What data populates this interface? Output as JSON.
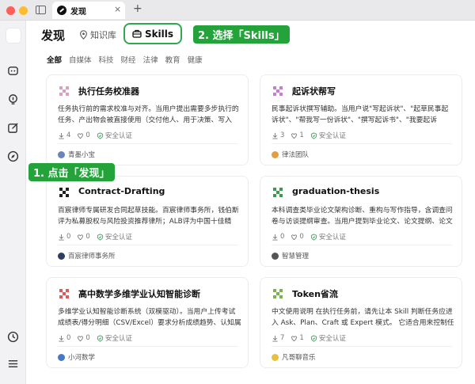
{
  "window": {
    "tab_title": "发现",
    "tab_close": "×",
    "tab_add": "+"
  },
  "header": {
    "title": "发现",
    "knowledge_tab": "知识库",
    "skills_tab": "Skills"
  },
  "callouts": {
    "step1": "1. 点击「发现」",
    "step2": "2. 选择「Skills」"
  },
  "categories": [
    "全部",
    "自媒体",
    "科技",
    "财经",
    "法律",
    "教育",
    "健康"
  ],
  "verified_label": "安全认证",
  "cards": [
    {
      "title": "执行任务校准器",
      "desc": "任务执行前的需求校准与对齐。当用户提出需要多步执行的任务、产出物会被直接使用（交付他人、用于决策、写入文...",
      "downloads": "4",
      "likes": "0",
      "author": "青墨小宝",
      "icon_color": "#d9a0c6",
      "avatar_color": "#6a86b8"
    },
    {
      "title": "起诉状帮写",
      "desc": "民事起诉状撰写辅助。当用户说\"写起诉状\"、\"起草民事起诉状\"、\"帮我写一份诉状\"、\"撰写起诉书\"、\"我要起诉XX\"，...",
      "downloads": "3",
      "likes": "1",
      "author": "律法团队",
      "icon_color": "#c77dd6",
      "avatar_color": "#e0a040"
    },
    {
      "title": "Contract-Drafting",
      "desc": "百宸律师专属研发合同起草技能。百宸律师事务所，钱伯斯评为私募股权与风险投资推荐律所；ALB评为中国十佳精品...",
      "downloads": "0",
      "likes": "0",
      "author": "百宸律师事务所",
      "icon_color": "#222222",
      "avatar_color": "#2d3e63"
    },
    {
      "title": "graduation-thesis",
      "desc": "本科调查类毕业论文架构诊断、重构与写作指导，含调查问卷与访谈提纲审查。当用户提到毕业论文、论文提纲、论文框...",
      "downloads": "0",
      "likes": "0",
      "author": "智慧管理",
      "icon_color": "#3a9a55",
      "avatar_color": "#555555"
    },
    {
      "title": "高中数学多维学业认知智能诊断",
      "desc": "多维学业认知智能诊断系统（双模驱动）。当用户上传考试成绩表/得分明细（CSV/Excel）要求分析成绩趋势、认知属性...",
      "downloads": "0",
      "likes": "0",
      "author": "小河数学",
      "icon_color": "#e05a5a",
      "avatar_color": "#4a78c8"
    },
    {
      "title": "Token省流",
      "desc": "中文使用说明 在执行任务前，请先让本 Skill 判断任务应进入 Ask、Plan、Craft 或 Expert 模式。 它适合用来控制任务...",
      "downloads": "7",
      "likes": "1",
      "author": "凡哥聊音乐",
      "icon_color": "#7ab34a",
      "avatar_color": "#e8c040"
    }
  ]
}
